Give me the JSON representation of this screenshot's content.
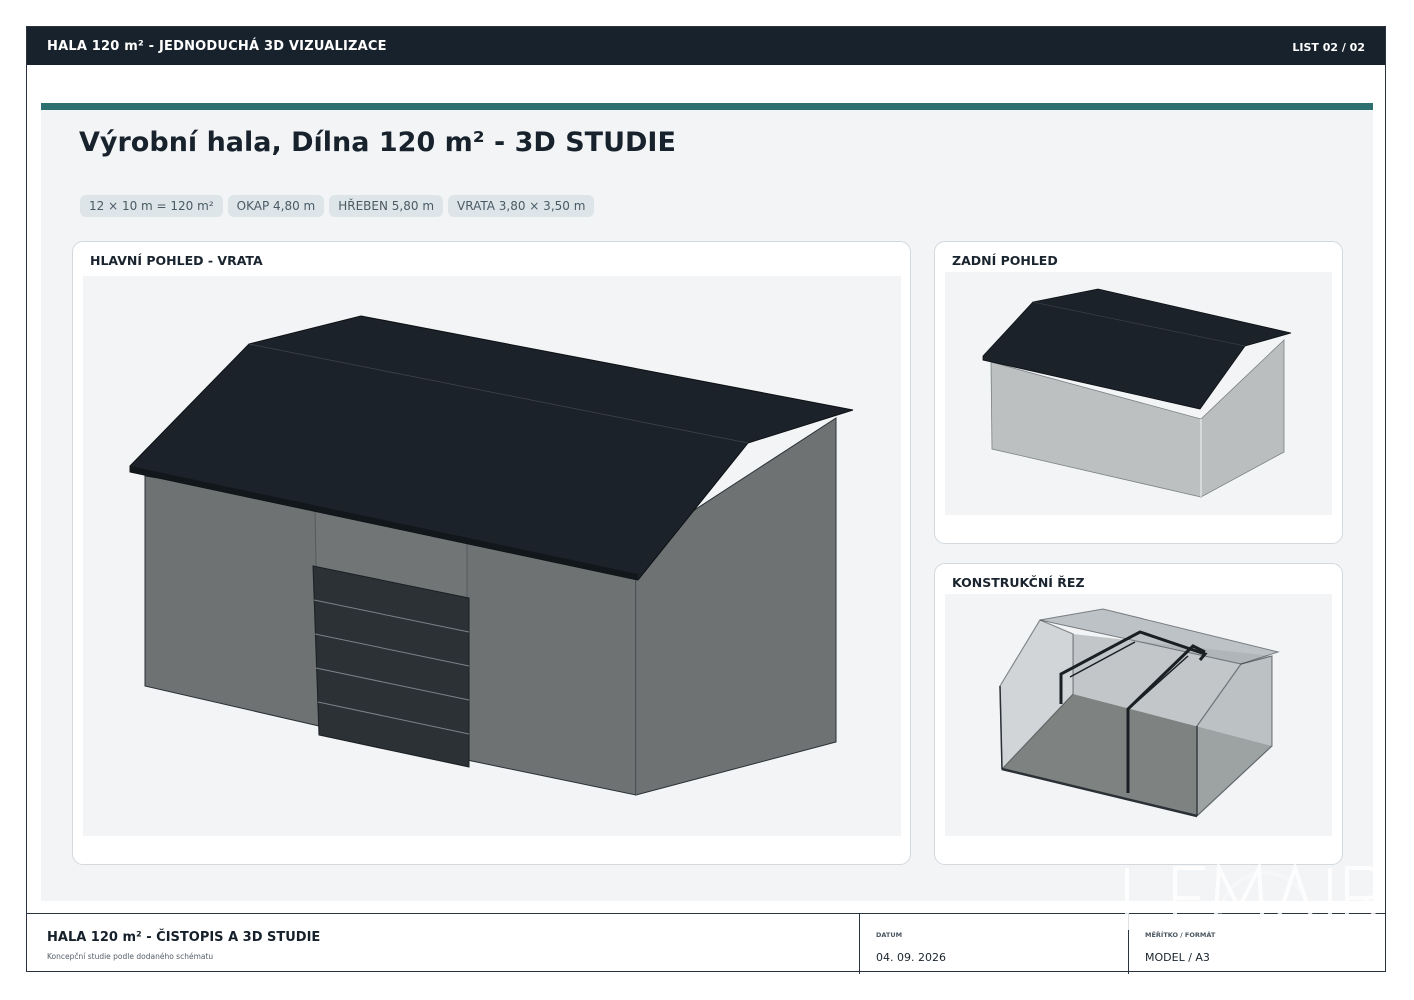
{
  "header": {
    "title": "HALA 120 m² - JEDNODUCHÁ 3D VIZUALIZACE",
    "sheet": "LIST 02 / 02"
  },
  "main": {
    "title": "Výrobní hala, Dílna 120 m² - 3D STUDIE",
    "chips": [
      "12 × 10 m = 120 m²",
      "OKAP 4,80 m",
      "HŘEBEN 5,80 m",
      "VRATA 3,80 × 3,50 m"
    ]
  },
  "views": {
    "main_view": "HLAVNÍ POHLED - VRATA",
    "rear_view": "ZADNÍ POHLED",
    "section_view": "KONSTRUKČNÍ ŘEZ"
  },
  "footer": {
    "title": "HALA 120 m² - ČISTOPIS A 3D STUDIE",
    "subtitle": "Koncepční studie podle dodaného schématu",
    "date_label": "DATUM",
    "date_value": "04. 09. 2026",
    "scale_label": "MĚŘÍTKO / FORMÁT",
    "scale_value": "MODEL / A3"
  },
  "watermark": {
    "text": "LEMAIR"
  },
  "colors": {
    "dark": "#18222c",
    "accent": "#2e7070",
    "roof": "#1c2229",
    "wall": "#6c7070",
    "door": "#2c3136"
  }
}
